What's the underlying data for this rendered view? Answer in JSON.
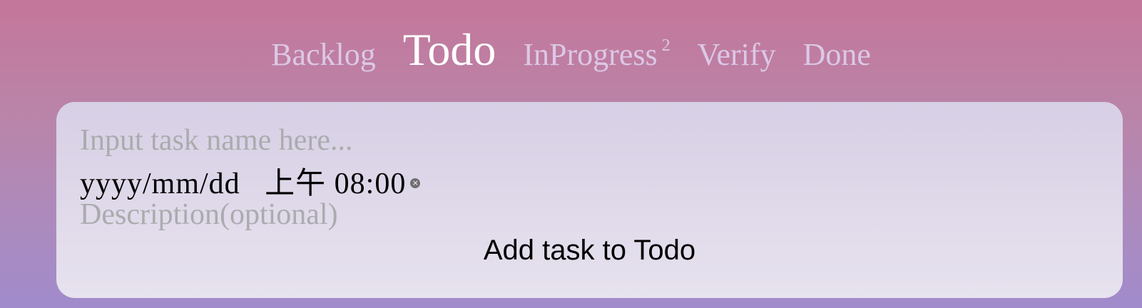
{
  "tabs": [
    {
      "label": "Backlog",
      "count": "",
      "active": false
    },
    {
      "label": "Todo",
      "count": "",
      "active": true
    },
    {
      "label": "InProgress",
      "count": "2",
      "active": false
    },
    {
      "label": "Verify",
      "count": "",
      "active": false
    },
    {
      "label": "Done",
      "count": "",
      "active": false
    }
  ],
  "form": {
    "name_placeholder": "Input task name here...",
    "name_value": "",
    "datetime_text": "yyyy/mm/dd   上午 08:00",
    "clear_icon": "×",
    "description_placeholder": "Description(optional)",
    "description_value": "",
    "add_button_label": "Add task to Todo"
  },
  "colors": {
    "background_top": "#c4779a",
    "background_bottom": "#a18bcc",
    "tab_inactive": "#dcc8e6",
    "tab_active": "#ffffff",
    "placeholder": "#ababae"
  }
}
